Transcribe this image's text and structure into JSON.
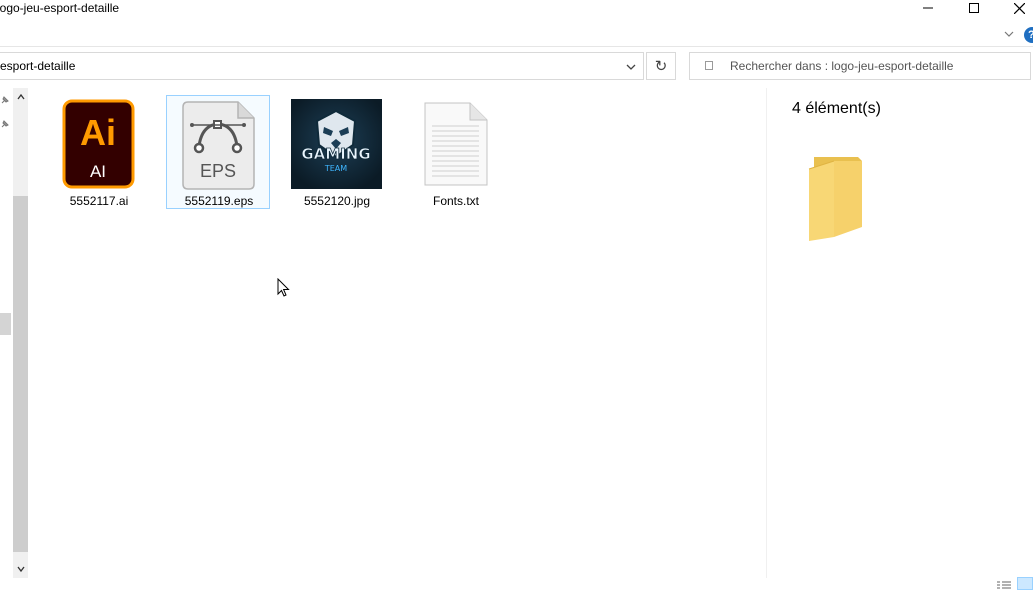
{
  "window": {
    "title": "logo-jeu-esport-detaille",
    "minimize_icon": "minimize-icon",
    "maximize_icon": "maximize-icon",
    "close_icon": "close-icon"
  },
  "toolbar": {
    "address_text": "esport-detaille",
    "search_placeholder": "Rechercher dans : logo-jeu-esport-detaille",
    "refresh_glyph": "↻"
  },
  "files": [
    {
      "name": "5552117.ai",
      "type": "ai",
      "icon_text": "Ai",
      "icon_sub": "AI",
      "accent": "#ff9a00",
      "bg": "#330000"
    },
    {
      "name": "5552119.eps",
      "type": "eps",
      "icon_text": "EPS",
      "selected": true
    },
    {
      "name": "5552120.jpg",
      "type": "jpg",
      "thumb_text": "GAMING",
      "thumb_sub": "TEAM"
    },
    {
      "name": "Fonts.txt",
      "type": "txt"
    }
  ],
  "details": {
    "count": "4 élément(s)"
  },
  "colors": {
    "selection_border": "#99d1ff",
    "selection_fill": "#f5fbff",
    "help_blue": "#1f6fc1",
    "folder_yellow": "#f8d775"
  }
}
